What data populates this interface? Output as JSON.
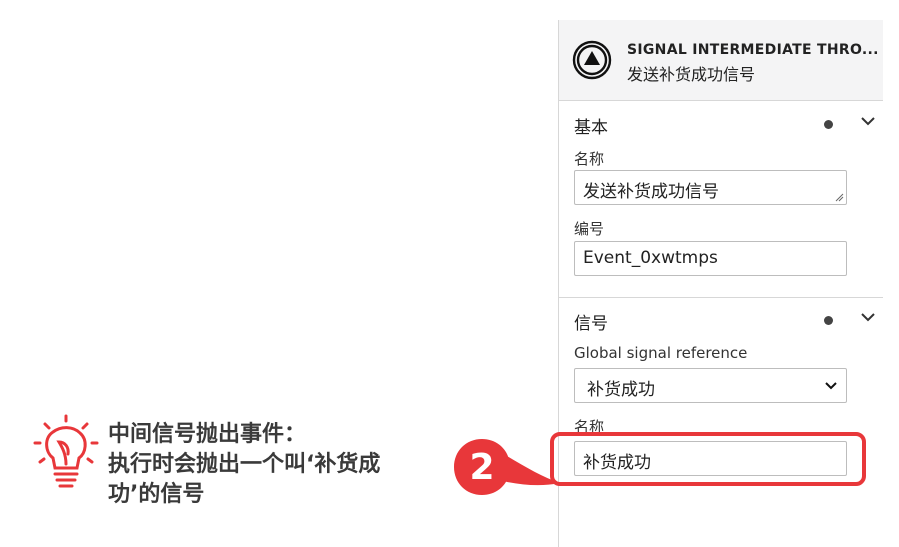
{
  "header": {
    "type_label": "SIGNAL INTERMEDIATE THRO...",
    "element_name": "发送补货成功信号"
  },
  "groups": {
    "basic": {
      "title": "基本",
      "name_label": "名称",
      "name_value": "发送补货成功信号",
      "id_label": "编号",
      "id_value": "Event_0xwtmps"
    },
    "signal": {
      "title": "信号",
      "global_ref_label": "Global signal reference",
      "global_ref_value": "补货成功",
      "name_label": "名称",
      "name_value": "补货成功"
    }
  },
  "annotation": {
    "step_number": "2",
    "line1": "中间信号抛出事件：",
    "line2": "执行时会抛出一个叫‘补货成",
    "line3": "功’的信号",
    "accent_color": "#e8373a"
  }
}
